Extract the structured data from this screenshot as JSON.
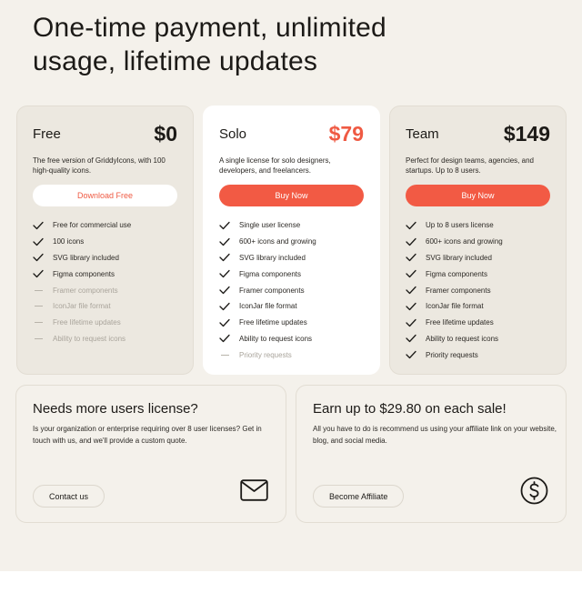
{
  "headline": "One-time payment, unlimited usage, lifetime updates",
  "plans": [
    {
      "name": "Free",
      "price": "$0",
      "description": "The free version of GriddyIcons, with 100 high-quality icons.",
      "button": "Download Free",
      "features": [
        {
          "text": "Free for commercial use",
          "included": true
        },
        {
          "text": "100 icons",
          "included": true
        },
        {
          "text": "SVG library included",
          "included": true
        },
        {
          "text": "Figma components",
          "included": true
        },
        {
          "text": "Framer components",
          "included": false
        },
        {
          "text": "IconJar file format",
          "included": false
        },
        {
          "text": "Free lifetime updates",
          "included": false
        },
        {
          "text": "Ability to request icons",
          "included": false
        }
      ]
    },
    {
      "name": "Solo",
      "price": "$79",
      "description": "A single license for solo designers, developers, and freelancers.",
      "button": "Buy Now",
      "features": [
        {
          "text": "Single user license",
          "included": true
        },
        {
          "text": "600+ icons and growing",
          "included": true
        },
        {
          "text": "SVG library included",
          "included": true
        },
        {
          "text": "Figma components",
          "included": true
        },
        {
          "text": "Framer components",
          "included": true
        },
        {
          "text": "IconJar file format",
          "included": true
        },
        {
          "text": "Free lifetime updates",
          "included": true
        },
        {
          "text": "Ability to request icons",
          "included": true
        },
        {
          "text": "Priority requests",
          "included": false
        }
      ]
    },
    {
      "name": "Team",
      "price": "$149",
      "description": "Perfect for design teams, agencies, and startups. Up to 8 users.",
      "button": "Buy Now",
      "features": [
        {
          "text": "Up to 8 users license",
          "included": true
        },
        {
          "text": "600+ icons and growing",
          "included": true
        },
        {
          "text": "SVG library included",
          "included": true
        },
        {
          "text": "Figma components",
          "included": true
        },
        {
          "text": "Framer components",
          "included": true
        },
        {
          "text": "IconJar file format",
          "included": true
        },
        {
          "text": "Free lifetime updates",
          "included": true
        },
        {
          "text": "Ability to request icons",
          "included": true
        },
        {
          "text": "Priority requests",
          "included": true
        }
      ]
    }
  ],
  "promos": {
    "license": {
      "title": "Needs more users license?",
      "text": "Is your organization or enterprise requiring over 8 user licenses? Get in touch with us, and we'll provide a custom quote.",
      "button": "Contact us",
      "icon": "envelope-icon"
    },
    "affiliate": {
      "title": "Earn up to $29.80 on each sale!",
      "text": "All you have to do is recommend us using your affiliate link on your website, blog, and social media.",
      "button": "Become Affiliate",
      "icon": "dollar-coin-icon"
    }
  },
  "colors": {
    "accent": "#f25a44",
    "background": "#f4f1eb",
    "card": "#ece8e0",
    "text": "#1c1a17",
    "muted": "#a9a49b"
  }
}
